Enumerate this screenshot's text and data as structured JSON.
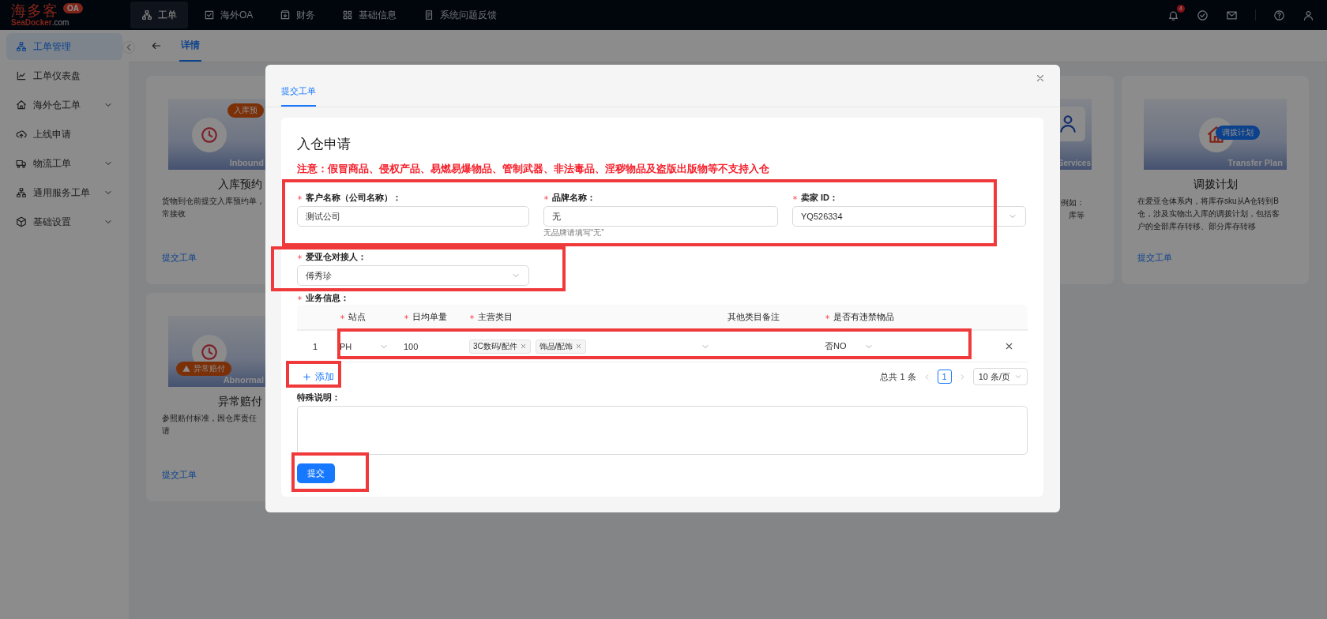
{
  "logo": {
    "name": "海多客",
    "badge": "OA",
    "brand": "SeaDocker",
    "domain": ".com"
  },
  "top_nav": [
    {
      "label": "工单",
      "selected": true
    },
    {
      "label": "海外OA",
      "selected": false
    },
    {
      "label": "财务",
      "selected": false
    },
    {
      "label": "基础信息",
      "selected": false
    },
    {
      "label": "系统问题反馈",
      "selected": false
    }
  ],
  "notifications": {
    "badge": "4"
  },
  "sidebar": {
    "items": [
      {
        "label": "工单管理",
        "selected": true,
        "kind": "link"
      },
      {
        "label": "工单仪表盘",
        "selected": false,
        "kind": "link"
      },
      {
        "label": "海外仓工单",
        "selected": false,
        "kind": "group"
      },
      {
        "label": "上线申请",
        "selected": false,
        "kind": "link"
      },
      {
        "label": "物流工单",
        "selected": false,
        "kind": "group"
      },
      {
        "label": "通用服务工单",
        "selected": false,
        "kind": "group"
      },
      {
        "label": "基础设置",
        "selected": false,
        "kind": "group"
      }
    ]
  },
  "page_tabs": [
    {
      "label": "详情",
      "selected": true
    }
  ],
  "cards": [
    {
      "kind": "full",
      "title": "入库预约",
      "image_badge": "入库预",
      "image_label": "Inbound",
      "description": [
        "货物到仓前提交入库预约单，",
        "常接收"
      ],
      "link": "提交工单"
    },
    {
      "kind": "partial",
      "image_label": "Services",
      "description": [
        "例如：",
        "库等"
      ]
    },
    {
      "kind": "full",
      "title": "调拨计划",
      "image_badge": "调拨计划",
      "image_label": "Transfer Plan",
      "description": [
        "在爱亚仓体系内，将库存sku从A仓转到B",
        "仓，涉及实物出入库的调拨计划，包括客",
        "户的全部库存转移、部分库存转移"
      ],
      "link": "提交工单"
    },
    {
      "kind": "full",
      "title": "异常赔付",
      "image_badge": "异常赔付",
      "image_label": "Abnormal",
      "description": [
        "参照赔付标准，因仓库责任",
        "请"
      ],
      "link": "提交工单"
    }
  ],
  "modal": {
    "tabs": [
      {
        "label": "提交工单",
        "selected": true
      }
    ],
    "form": {
      "title": "入仓申请",
      "warning": "注意：假冒商品、侵权产品、易燃易爆物品、管制武器、非法毒品、淫秽物品及盗版出版物等不支持入仓",
      "fields": [
        {
          "label": "客户名称（公司名称）：",
          "value": "测试公司",
          "kind": "text",
          "required": true
        },
        {
          "label": "品牌名称：",
          "value": "无",
          "kind": "text",
          "required": true,
          "hint": "无品牌请填写“无”"
        },
        {
          "label": "卖家 ID：",
          "value": "YQ526334",
          "kind": "select",
          "required": true
        },
        {
          "label": "爱亚仓对接人：",
          "value": "傅秀珍",
          "kind": "select",
          "required": true
        }
      ],
      "business": {
        "label": "业务信息：",
        "required": true,
        "columns": [
          {
            "label": "站点",
            "required": true
          },
          {
            "label": "日均单量",
            "required": true
          },
          {
            "label": "主营类目",
            "required": true
          },
          {
            "label": "其他类目备注",
            "required": false
          },
          {
            "label": "是否有违禁物品",
            "required": true
          }
        ],
        "rows": [
          {
            "index": "1",
            "site": "PH",
            "daily_volume": "100",
            "categories": [
              "3C数码/配件",
              "饰品/配饰"
            ],
            "prohibited": "否NO"
          }
        ]
      },
      "add_button": "添加",
      "pagination": {
        "total": "总共 1 条",
        "pages": [
          {
            "label": "1",
            "selected": true
          }
        ],
        "page_size": "10 条/页"
      },
      "remarks": {
        "label": "特殊说明："
      },
      "submit": "提交"
    }
  }
}
